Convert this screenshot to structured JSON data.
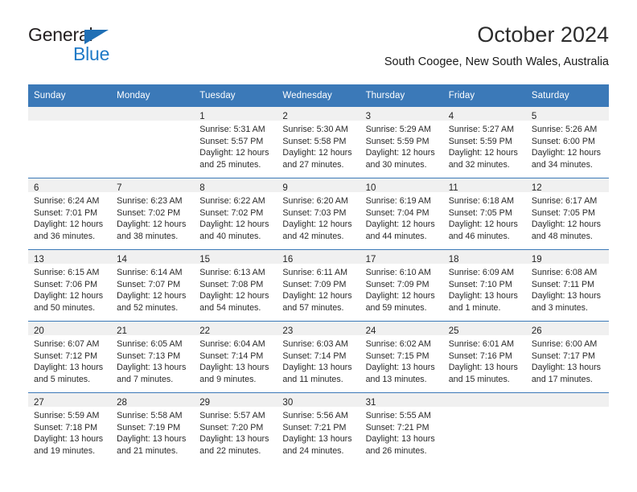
{
  "brand": {
    "name_top": "General",
    "name_bottom": "Blue",
    "accent_color": "#1f7ac7",
    "triangle_color": "#1f6fb5"
  },
  "header": {
    "title": "October 2024",
    "location": "South Coogee, New South Wales, Australia"
  },
  "theme": {
    "header_bg": "#3b79b8",
    "day_band_bg": "#f0f0f0",
    "text_color": "#2a2a2a"
  },
  "weekday_headers": [
    "Sunday",
    "Monday",
    "Tuesday",
    "Wednesday",
    "Thursday",
    "Friday",
    "Saturday"
  ],
  "weeks": [
    [
      {
        "day": "",
        "sunrise": "",
        "sunset": "",
        "daylight": ""
      },
      {
        "day": "",
        "sunrise": "",
        "sunset": "",
        "daylight": ""
      },
      {
        "day": "1",
        "sunrise": "Sunrise: 5:31 AM",
        "sunset": "Sunset: 5:57 PM",
        "daylight": "Daylight: 12 hours and 25 minutes."
      },
      {
        "day": "2",
        "sunrise": "Sunrise: 5:30 AM",
        "sunset": "Sunset: 5:58 PM",
        "daylight": "Daylight: 12 hours and 27 minutes."
      },
      {
        "day": "3",
        "sunrise": "Sunrise: 5:29 AM",
        "sunset": "Sunset: 5:59 PM",
        "daylight": "Daylight: 12 hours and 30 minutes."
      },
      {
        "day": "4",
        "sunrise": "Sunrise: 5:27 AM",
        "sunset": "Sunset: 5:59 PM",
        "daylight": "Daylight: 12 hours and 32 minutes."
      },
      {
        "day": "5",
        "sunrise": "Sunrise: 5:26 AM",
        "sunset": "Sunset: 6:00 PM",
        "daylight": "Daylight: 12 hours and 34 minutes."
      }
    ],
    [
      {
        "day": "6",
        "sunrise": "Sunrise: 6:24 AM",
        "sunset": "Sunset: 7:01 PM",
        "daylight": "Daylight: 12 hours and 36 minutes."
      },
      {
        "day": "7",
        "sunrise": "Sunrise: 6:23 AM",
        "sunset": "Sunset: 7:02 PM",
        "daylight": "Daylight: 12 hours and 38 minutes."
      },
      {
        "day": "8",
        "sunrise": "Sunrise: 6:22 AM",
        "sunset": "Sunset: 7:02 PM",
        "daylight": "Daylight: 12 hours and 40 minutes."
      },
      {
        "day": "9",
        "sunrise": "Sunrise: 6:20 AM",
        "sunset": "Sunset: 7:03 PM",
        "daylight": "Daylight: 12 hours and 42 minutes."
      },
      {
        "day": "10",
        "sunrise": "Sunrise: 6:19 AM",
        "sunset": "Sunset: 7:04 PM",
        "daylight": "Daylight: 12 hours and 44 minutes."
      },
      {
        "day": "11",
        "sunrise": "Sunrise: 6:18 AM",
        "sunset": "Sunset: 7:05 PM",
        "daylight": "Daylight: 12 hours and 46 minutes."
      },
      {
        "day": "12",
        "sunrise": "Sunrise: 6:17 AM",
        "sunset": "Sunset: 7:05 PM",
        "daylight": "Daylight: 12 hours and 48 minutes."
      }
    ],
    [
      {
        "day": "13",
        "sunrise": "Sunrise: 6:15 AM",
        "sunset": "Sunset: 7:06 PM",
        "daylight": "Daylight: 12 hours and 50 minutes."
      },
      {
        "day": "14",
        "sunrise": "Sunrise: 6:14 AM",
        "sunset": "Sunset: 7:07 PM",
        "daylight": "Daylight: 12 hours and 52 minutes."
      },
      {
        "day": "15",
        "sunrise": "Sunrise: 6:13 AM",
        "sunset": "Sunset: 7:08 PM",
        "daylight": "Daylight: 12 hours and 54 minutes."
      },
      {
        "day": "16",
        "sunrise": "Sunrise: 6:11 AM",
        "sunset": "Sunset: 7:09 PM",
        "daylight": "Daylight: 12 hours and 57 minutes."
      },
      {
        "day": "17",
        "sunrise": "Sunrise: 6:10 AM",
        "sunset": "Sunset: 7:09 PM",
        "daylight": "Daylight: 12 hours and 59 minutes."
      },
      {
        "day": "18",
        "sunrise": "Sunrise: 6:09 AM",
        "sunset": "Sunset: 7:10 PM",
        "daylight": "Daylight: 13 hours and 1 minute."
      },
      {
        "day": "19",
        "sunrise": "Sunrise: 6:08 AM",
        "sunset": "Sunset: 7:11 PM",
        "daylight": "Daylight: 13 hours and 3 minutes."
      }
    ],
    [
      {
        "day": "20",
        "sunrise": "Sunrise: 6:07 AM",
        "sunset": "Sunset: 7:12 PM",
        "daylight": "Daylight: 13 hours and 5 minutes."
      },
      {
        "day": "21",
        "sunrise": "Sunrise: 6:05 AM",
        "sunset": "Sunset: 7:13 PM",
        "daylight": "Daylight: 13 hours and 7 minutes."
      },
      {
        "day": "22",
        "sunrise": "Sunrise: 6:04 AM",
        "sunset": "Sunset: 7:14 PM",
        "daylight": "Daylight: 13 hours and 9 minutes."
      },
      {
        "day": "23",
        "sunrise": "Sunrise: 6:03 AM",
        "sunset": "Sunset: 7:14 PM",
        "daylight": "Daylight: 13 hours and 11 minutes."
      },
      {
        "day": "24",
        "sunrise": "Sunrise: 6:02 AM",
        "sunset": "Sunset: 7:15 PM",
        "daylight": "Daylight: 13 hours and 13 minutes."
      },
      {
        "day": "25",
        "sunrise": "Sunrise: 6:01 AM",
        "sunset": "Sunset: 7:16 PM",
        "daylight": "Daylight: 13 hours and 15 minutes."
      },
      {
        "day": "26",
        "sunrise": "Sunrise: 6:00 AM",
        "sunset": "Sunset: 7:17 PM",
        "daylight": "Daylight: 13 hours and 17 minutes."
      }
    ],
    [
      {
        "day": "27",
        "sunrise": "Sunrise: 5:59 AM",
        "sunset": "Sunset: 7:18 PM",
        "daylight": "Daylight: 13 hours and 19 minutes."
      },
      {
        "day": "28",
        "sunrise": "Sunrise: 5:58 AM",
        "sunset": "Sunset: 7:19 PM",
        "daylight": "Daylight: 13 hours and 21 minutes."
      },
      {
        "day": "29",
        "sunrise": "Sunrise: 5:57 AM",
        "sunset": "Sunset: 7:20 PM",
        "daylight": "Daylight: 13 hours and 22 minutes."
      },
      {
        "day": "30",
        "sunrise": "Sunrise: 5:56 AM",
        "sunset": "Sunset: 7:21 PM",
        "daylight": "Daylight: 13 hours and 24 minutes."
      },
      {
        "day": "31",
        "sunrise": "Sunrise: 5:55 AM",
        "sunset": "Sunset: 7:21 PM",
        "daylight": "Daylight: 13 hours and 26 minutes."
      },
      {
        "day": "",
        "sunrise": "",
        "sunset": "",
        "daylight": ""
      },
      {
        "day": "",
        "sunrise": "",
        "sunset": "",
        "daylight": ""
      }
    ]
  ]
}
